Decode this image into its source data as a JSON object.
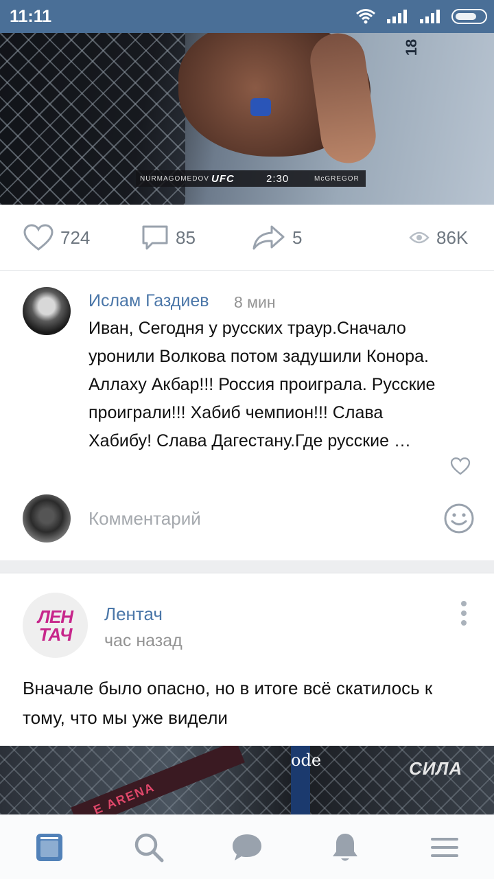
{
  "status_bar": {
    "time": "11:11",
    "signal1": "",
    "signal2": ""
  },
  "video1": {
    "scoreboard": {
      "left_name": "NURMAGOMEDOV",
      "brand": "UFC",
      "clock": "2:30",
      "right_name": "McGREGOR"
    },
    "round_marker": "18"
  },
  "post_actions": {
    "likes": "724",
    "comments": "85",
    "shares": "5",
    "views": "86K"
  },
  "comment": {
    "author": "Ислам Газдиев",
    "time": "8 мин",
    "text": "Иван, Сегодня у русских траур.Сначало уронили Волкова потом задушили Конора. Аллаху Акбар!!! Россия проиграла. Русские проиграли!!!  Хабиб чемпион!!! Слава Хабибу! Слава Дагестану.Где русские …"
  },
  "compose": {
    "placeholder": "Комментарий"
  },
  "post": {
    "author": "Лентач",
    "logo_text_1": "ЛЕН",
    "logo_text_2": "ТАЧ",
    "time": "час назад",
    "text": "Вначале было опасно, но в итоге всё скатилось к тому, что мы уже видели"
  },
  "video2": {
    "rail_text": "E ARENA",
    "pillar_text": "ode",
    "overlay_text": "СИЛА"
  },
  "nav": [
    "news-icon",
    "search-icon",
    "messages-icon",
    "notifications-icon",
    "menu-icon"
  ],
  "colors": {
    "accent": "#4a76a8",
    "statusbar": "#4a6f97",
    "brand_lenta": "#c7268b"
  }
}
